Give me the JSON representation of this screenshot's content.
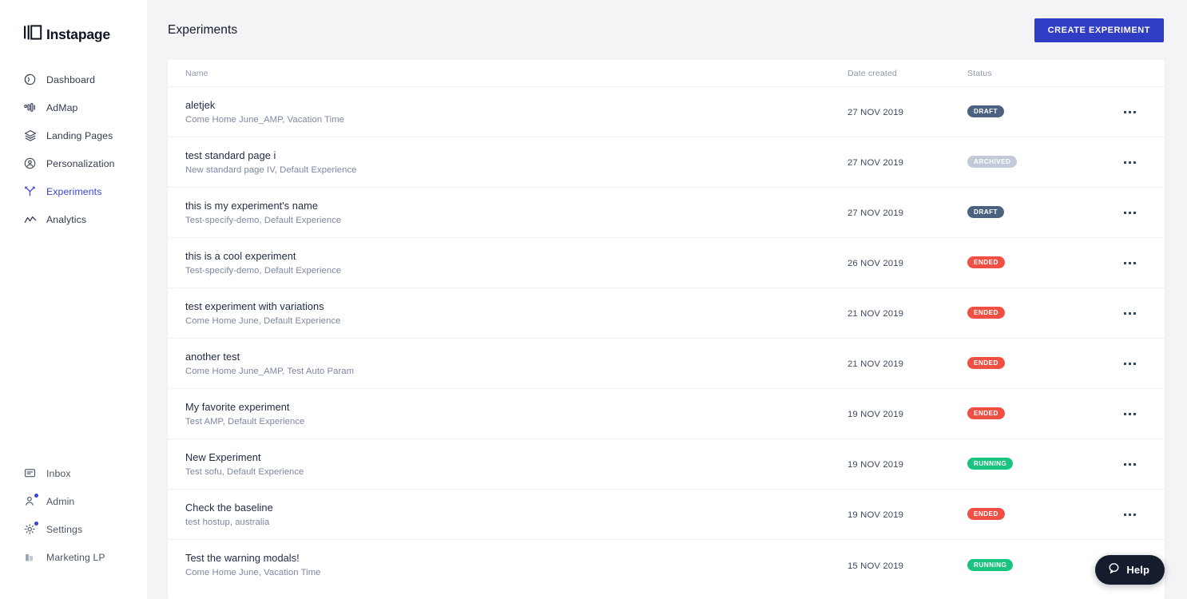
{
  "brand": {
    "name": "Instapage",
    "accent": "#3b43d8",
    "button_blue": "#2f3cc4"
  },
  "sidebar": {
    "primary_items": [
      {
        "label": "Dashboard",
        "icon": "dashboard-icon",
        "active": false,
        "badge": false
      },
      {
        "label": "AdMap",
        "icon": "admap-icon",
        "active": false,
        "badge": false
      },
      {
        "label": "Landing Pages",
        "icon": "layers-icon",
        "active": false,
        "badge": false
      },
      {
        "label": "Personalization",
        "icon": "person-circle-icon",
        "active": false,
        "badge": false
      },
      {
        "label": "Experiments",
        "icon": "experiments-icon",
        "active": true,
        "badge": false
      },
      {
        "label": "Analytics",
        "icon": "analytics-icon",
        "active": false,
        "badge": false
      }
    ],
    "bottom_items": [
      {
        "label": "Inbox",
        "icon": "inbox-icon",
        "badge": false
      },
      {
        "label": "Admin",
        "icon": "admin-icon",
        "badge": true
      },
      {
        "label": "Settings",
        "icon": "gear-icon",
        "badge": true
      },
      {
        "label": "Marketing LP",
        "icon": "building-icon",
        "badge": false
      }
    ]
  },
  "header": {
    "title": "Experiments",
    "create_button": "CREATE EXPERIMENT"
  },
  "table": {
    "columns": {
      "name": "Name",
      "date": "Date created",
      "status": "Status"
    },
    "rows": [
      {
        "name": "aletjek",
        "sub": "Come Home June_AMP, Vacation Time",
        "date": "27 NOV 2019",
        "status": "DRAFT",
        "status_kind": "draft"
      },
      {
        "name": "test standard page i",
        "sub": "New standard page IV, Default Experience",
        "date": "27 NOV 2019",
        "status": "ARCHIVED",
        "status_kind": "archived"
      },
      {
        "name": "this is my experiment's name",
        "sub": "Test-specify-demo, Default Experience",
        "date": "27 NOV 2019",
        "status": "DRAFT",
        "status_kind": "draft"
      },
      {
        "name": "this is a cool experiment",
        "sub": "Test-specify-demo, Default Experience",
        "date": "26 NOV 2019",
        "status": "ENDED",
        "status_kind": "ended"
      },
      {
        "name": "test experiment with variations",
        "sub": "Come Home June, Default Experience",
        "date": "21 NOV 2019",
        "status": "ENDED",
        "status_kind": "ended"
      },
      {
        "name": "another test",
        "sub": "Come Home June_AMP, Test Auto Param",
        "date": "21 NOV 2019",
        "status": "ENDED",
        "status_kind": "ended"
      },
      {
        "name": "My favorite experiment",
        "sub": "Test AMP, Default Experience",
        "date": "19 NOV 2019",
        "status": "ENDED",
        "status_kind": "ended"
      },
      {
        "name": "New Experiment",
        "sub": "Test sofu, Default Experience",
        "date": "19 NOV 2019",
        "status": "RUNNING",
        "status_kind": "running"
      },
      {
        "name": "Check the baseline",
        "sub": "test hostup, australia",
        "date": "19 NOV 2019",
        "status": "ENDED",
        "status_kind": "ended"
      },
      {
        "name": "Test the warning modals!",
        "sub": "Come Home June, Vacation Time",
        "date": "15 NOV 2019",
        "status": "RUNNING",
        "status_kind": "running"
      }
    ]
  },
  "help_widget": {
    "label": "Help",
    "icon": "chat-bubble-icon"
  },
  "status_colors": {
    "draft": "#4b6180",
    "archived": "#c2c9d8",
    "ended": "#f05044",
    "running": "#19c47e"
  }
}
